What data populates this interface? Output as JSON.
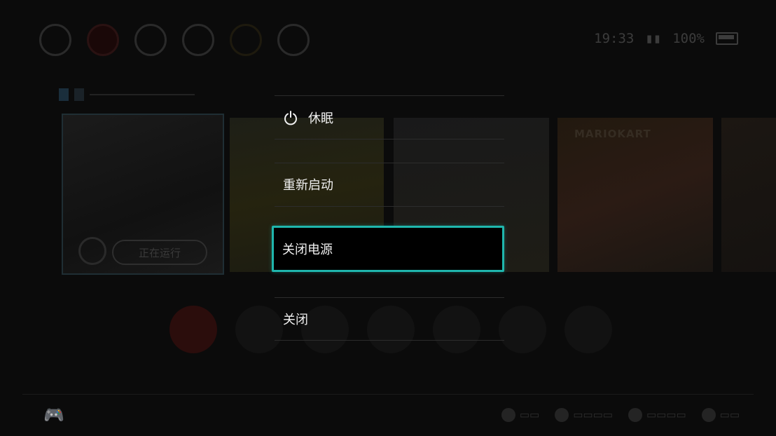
{
  "status": {
    "time": "19:33",
    "battery_percent": "100%"
  },
  "home": {
    "running_label": "正在运行",
    "tile3_label": "MARIOKART"
  },
  "power_menu": {
    "items": [
      {
        "label": "休眠",
        "icon": "power-icon"
      },
      {
        "label": "重新启动"
      },
      {
        "label": "关闭电源",
        "selected": true
      },
      {
        "label": "关闭"
      }
    ],
    "accent_color": "#1fb6ad"
  }
}
